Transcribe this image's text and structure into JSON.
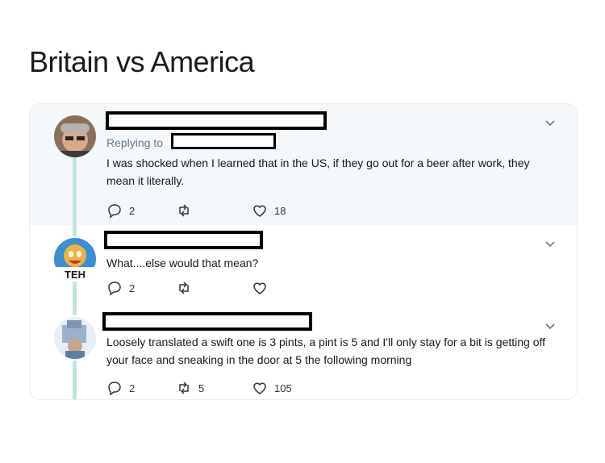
{
  "title": "Britain vs America",
  "tweets": [
    {
      "replying_to": "Replying to",
      "text": "I was shocked when I learned that in the US, if they go out for a beer after work, they mean it literally.",
      "reply_count": "2",
      "retweet_count": "",
      "like_count": "18"
    },
    {
      "avatar_text": "TEH",
      "text": "What....else would that mean?",
      "reply_count": "2",
      "retweet_count": "",
      "like_count": ""
    },
    {
      "text": "Loosely translated a swift one is 3 pints, a pint is 5 and I'll only stay for a bit is getting off your face and sneaking in the door at 5 the following morning",
      "reply_count": "2",
      "retweet_count": "5",
      "like_count": "105"
    }
  ],
  "icons": {
    "reply": "reply-icon",
    "retweet": "retweet-icon",
    "like": "heart-icon",
    "more": "chevron-down-icon"
  },
  "colors": {
    "thread_line": "#c2e4d9",
    "highlight_bg": "#f5f8fa",
    "muted": "#657786"
  }
}
